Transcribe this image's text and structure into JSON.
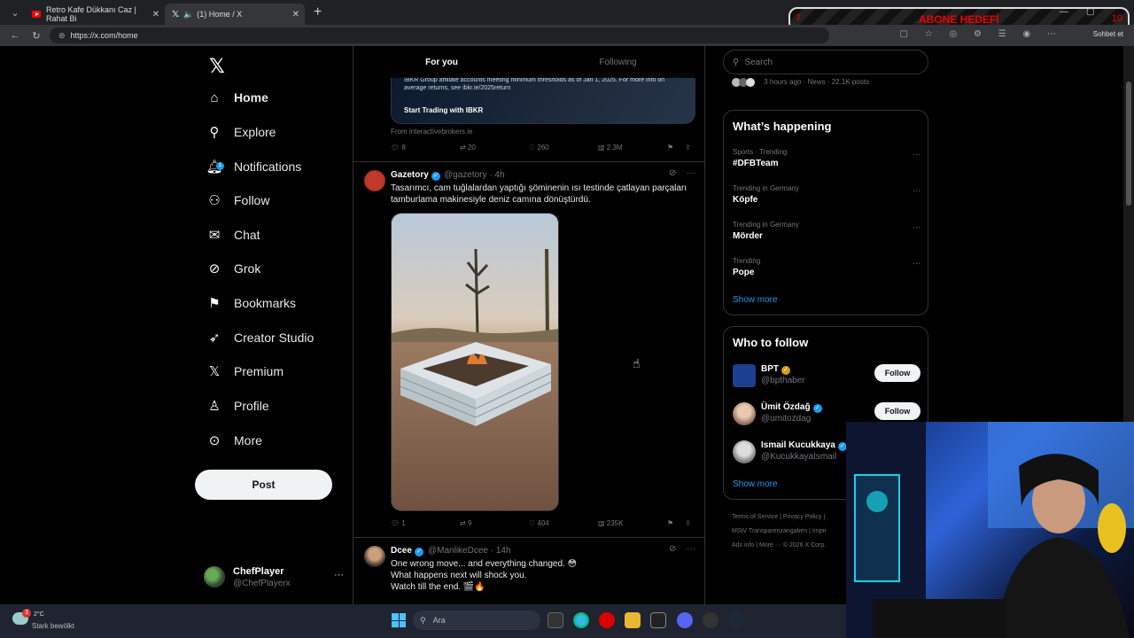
{
  "browser": {
    "tabs": [
      {
        "title": "Retro Kafe Dükkanı Caz | Rahat Bi",
        "active": false
      },
      {
        "title": "(1) Home / X",
        "active": true
      }
    ],
    "url": "https://x.com/home",
    "overlay_text": "ABONE HEDEFİ",
    "overlay_left": "7",
    "overlay_right": "10",
    "sohbet": "Sohbet et"
  },
  "nav": {
    "items": [
      {
        "label": "Home",
        "icon": "home-icon"
      },
      {
        "label": "Explore",
        "icon": "search-icon"
      },
      {
        "label": "Notifications",
        "icon": "bell-icon"
      },
      {
        "label": "Follow",
        "icon": "add-person-icon"
      },
      {
        "label": "Chat",
        "icon": "mail-icon"
      },
      {
        "label": "Grok",
        "icon": "grok-icon"
      },
      {
        "label": "Bookmarks",
        "icon": "bookmark-icon"
      },
      {
        "label": "Creator Studio",
        "icon": "rocket-icon"
      },
      {
        "label": "Premium",
        "icon": "x-icon"
      },
      {
        "label": "Profile",
        "icon": "person-icon"
      },
      {
        "label": "More",
        "icon": "more-circle-icon"
      }
    ],
    "notification_count": "1",
    "post_label": "Post",
    "account": {
      "name": "ChefPlayer",
      "handle": "@ChefPlayerx"
    }
  },
  "timeline": {
    "tabs": [
      "For you",
      "Following"
    ],
    "ad": {
      "text": "IBKR Group affiliate accounts meeting minimum thresholds as of Jan 1, 2025. For more info on average returns, see ibkr.ie/2025return",
      "cta": "Start Trading with IBKR",
      "from": "From interactivebrokers.ie",
      "stats": {
        "replies": "8",
        "reposts": "20",
        "likes": "260",
        "views": "2.3M"
      }
    },
    "tweet1": {
      "name": "Gazetory",
      "handle": "@gazetory · 4h",
      "text": "Tasarımcı, cam tuğlalardan yaptığı şöminenin ısı testinde çatlayan parçaları tamburlama makinesiyle deniz camına dönüştürdü.",
      "stats": {
        "replies": "1",
        "reposts": "9",
        "likes": "404",
        "views": "235K"
      }
    },
    "tweet2": {
      "name": "Dcee",
      "handle": "@ManlikeDcee · 14h",
      "line1": "One wrong move... and everything changed. 😳",
      "line2": "What happens next will shock you.",
      "line3": "Watch till the end. 🎬🔥"
    }
  },
  "right": {
    "search_placeholder": "Search",
    "news_meta": "3 hours ago · News · 22.1K posts",
    "happening_title": "What’s happening",
    "trends": [
      {
        "category": "Sports · Trending",
        "title": "#DFBTeam"
      },
      {
        "category": "Trending in Germany",
        "title": "Köpfe"
      },
      {
        "category": "Trending in Germany",
        "title": "Mörder"
      },
      {
        "category": "Trending",
        "title": "Pope"
      }
    ],
    "show_more": "Show more",
    "wtf_title": "Who to follow",
    "who_to_follow": [
      {
        "name": "BPT",
        "handle": "@bpthaber",
        "button": "Follow"
      },
      {
        "name": "Ümit Özdağ",
        "handle": "@umitozdag",
        "button": "Follow"
      },
      {
        "name": "Ismail Kucukkaya",
        "handle": "@KucukkayaIsmail",
        "button": ""
      }
    ],
    "show_more2": "Show more",
    "footer1": "Terms of Service  |  Privacy Policy  |",
    "footer2": "MStV Transparenzangaben  |  Impri",
    "footer3": "Ads info  |  More ···  © 2026 X Corp."
  },
  "taskbar": {
    "temp": "2°C",
    "weather": "Stark bewölkt",
    "weather_badge": "3",
    "search": "Ara"
  }
}
